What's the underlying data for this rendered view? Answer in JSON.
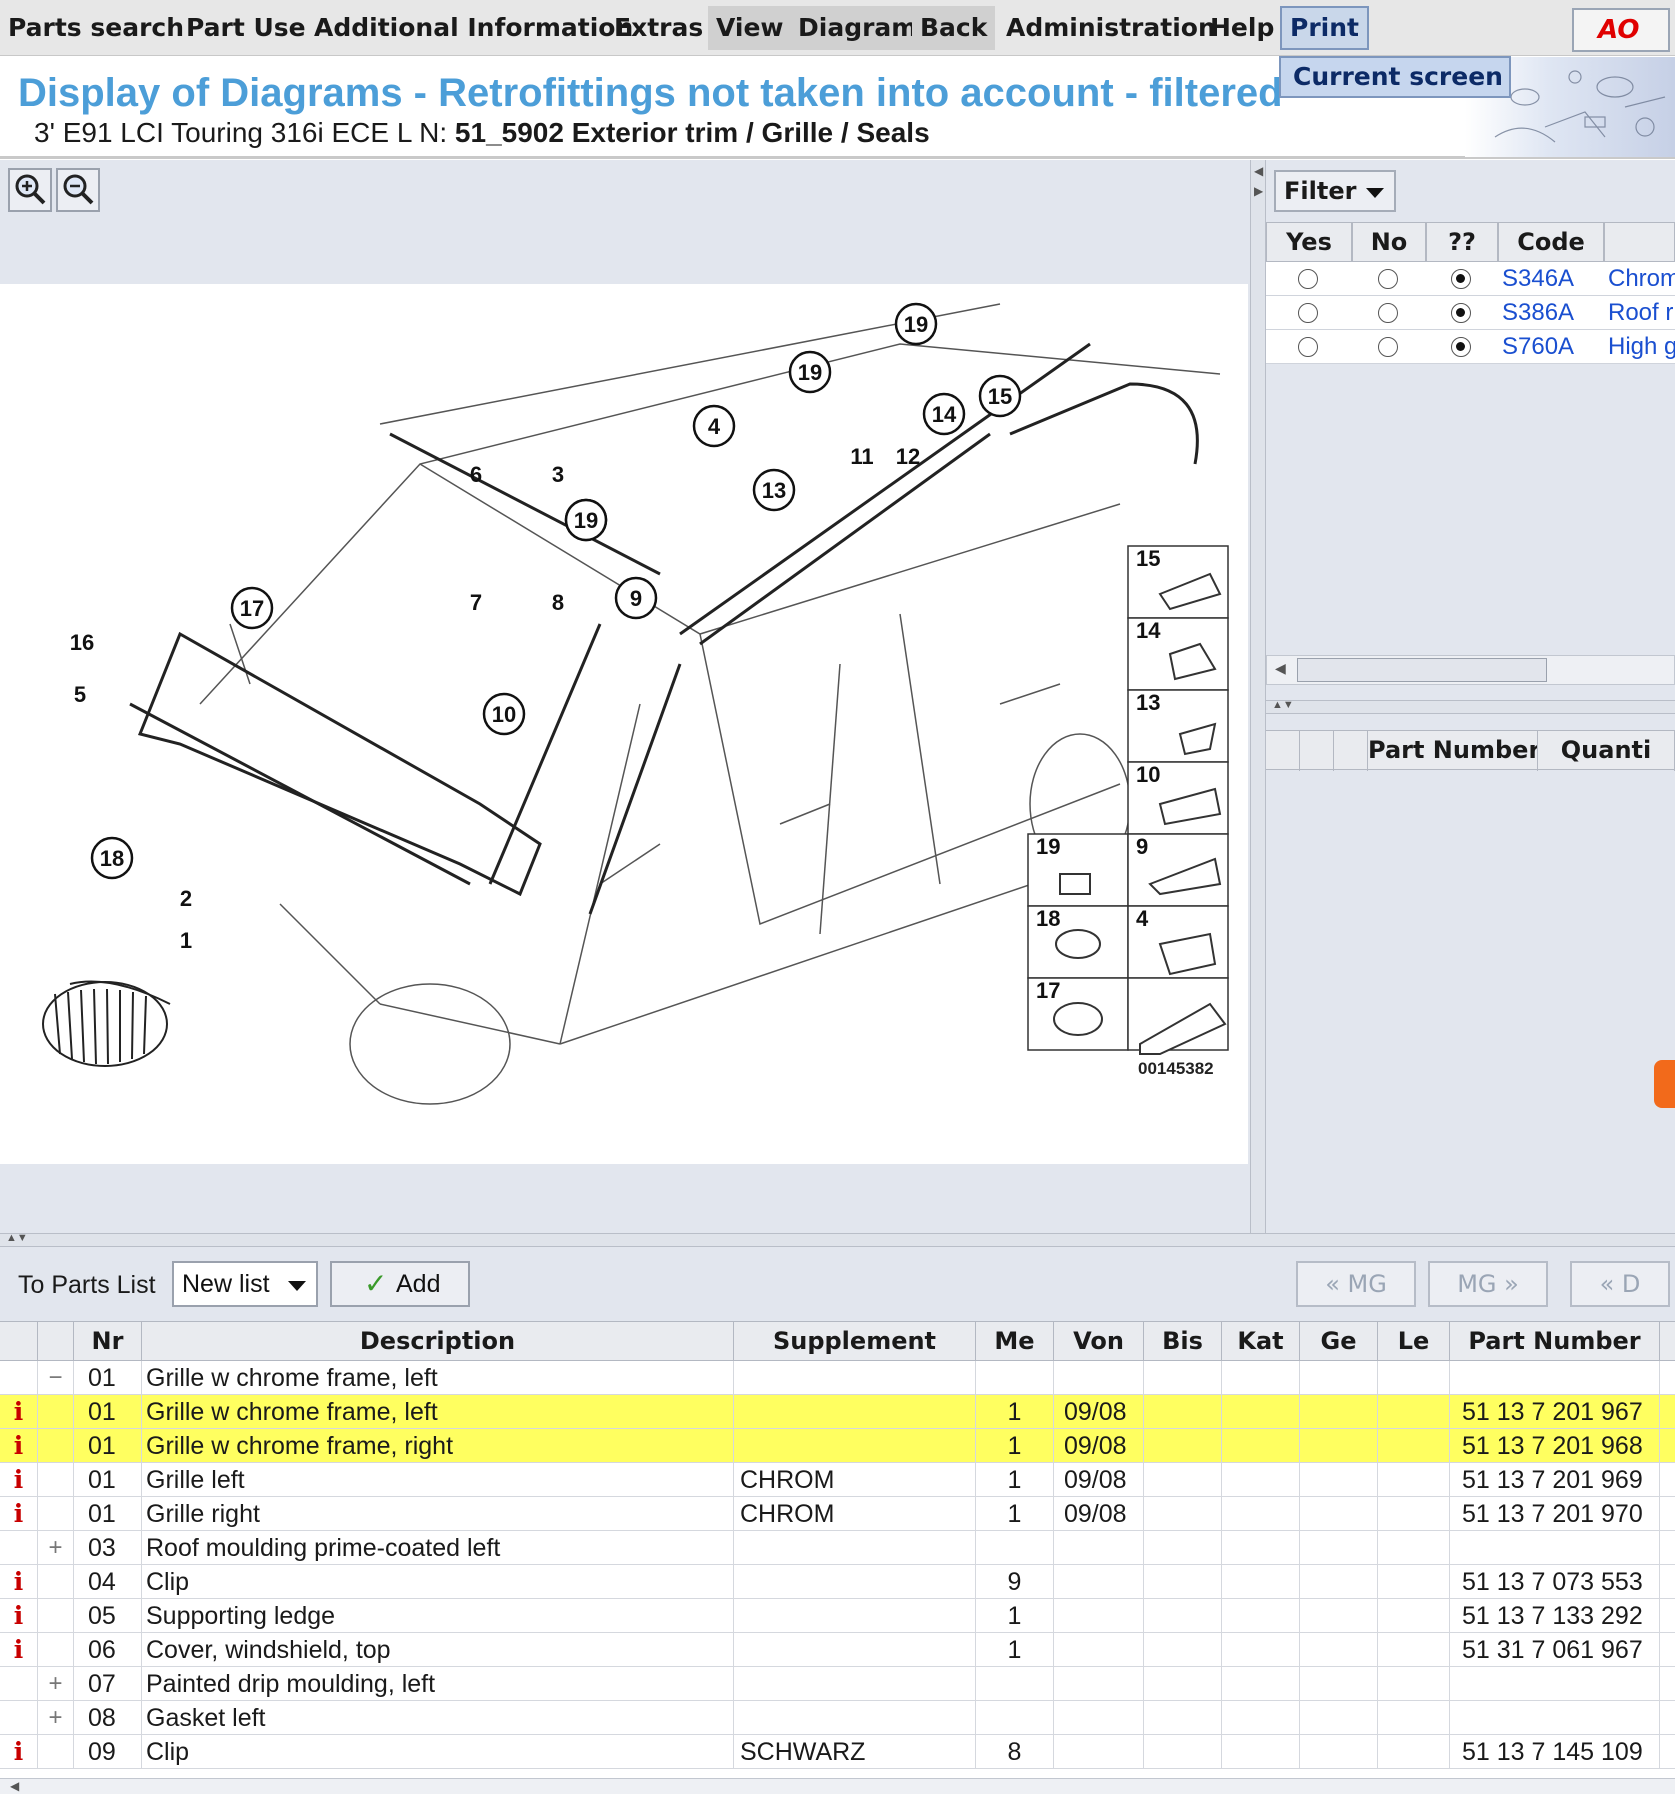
{
  "menu": {
    "items": [
      {
        "label": "Parts search"
      },
      {
        "label": "Part Use"
      },
      {
        "label": "Additional Information"
      },
      {
        "label": "Extras"
      },
      {
        "label": "View"
      },
      {
        "label": "Diagram"
      },
      {
        "label": "Back"
      },
      {
        "label": "Administration"
      },
      {
        "label": "Help"
      },
      {
        "label": "Print"
      }
    ],
    "print_dropdown": "Current screen",
    "logo_icon": "ao-logo-icon"
  },
  "header": {
    "title": "Display of Diagrams - Retrofittings not taken into account - filtered",
    "vehicle": "3' E91 LCI Touring 316i ECE  L N: ",
    "group": "51_5902 Exterior trim / Grille / Seals"
  },
  "diagram": {
    "zoom_in_icon": "zoom-in-icon",
    "zoom_out_icon": "zoom-out-icon",
    "callouts": [
      "19",
      "19",
      "19",
      "4",
      "3",
      "6",
      "19",
      "13",
      "11",
      "12",
      "14",
      "15",
      "9",
      "8",
      "7",
      "17",
      "16",
      "5",
      "10",
      "18",
      "2",
      "1"
    ],
    "legend": [
      "15",
      "14",
      "13",
      "10",
      "19",
      "9",
      "18",
      "4",
      "17"
    ],
    "image_number": "00145382"
  },
  "filter": {
    "button_label": "Filter",
    "columns": [
      "Yes",
      "No",
      "??",
      "Code",
      ""
    ],
    "rows": [
      {
        "code": "S346A",
        "desc": "Chrom",
        "selected": "??"
      },
      {
        "code": "S386A",
        "desc": "Roof r",
        "selected": "??"
      },
      {
        "code": "S760A",
        "desc": "High g",
        "selected": "??"
      }
    ],
    "parts_columns": [
      "",
      "",
      "",
      "Part Number",
      "Quanti"
    ]
  },
  "toolbar": {
    "label": "To Parts List",
    "list_select": "New list",
    "add_label": "Add",
    "prev_mg": "« MG",
    "next_mg": "MG »",
    "prev_d": "« D"
  },
  "parts": {
    "columns": [
      "",
      "",
      "Nr",
      "Description",
      "Supplement",
      "Me",
      "Von",
      "Bis",
      "Kat",
      "Ge",
      "Le",
      "Part Number"
    ],
    "rows": [
      {
        "icon": "",
        "tree": "−",
        "nr": "01",
        "desc": "Grille w chrome frame, left",
        "supp": "",
        "me": "",
        "von": "",
        "pn": "",
        "hl": false
      },
      {
        "icon": "i",
        "tree": "",
        "nr": "01",
        "desc": "Grille w chrome frame, left",
        "supp": "",
        "me": "1",
        "von": "09/08",
        "pn": "51 13 7 201 967",
        "hl": true
      },
      {
        "icon": "i",
        "tree": "",
        "nr": "01",
        "desc": "Grille w chrome frame, right",
        "supp": "",
        "me": "1",
        "von": "09/08",
        "pn": "51 13 7 201 968",
        "hl": true
      },
      {
        "icon": "i",
        "tree": "",
        "nr": "01",
        "desc": "Grille left",
        "supp": "CHROM",
        "me": "1",
        "von": "09/08",
        "pn": "51 13 7 201 969",
        "hl": false
      },
      {
        "icon": "i",
        "tree": "",
        "nr": "01",
        "desc": "Grille right",
        "supp": "CHROM",
        "me": "1",
        "von": "09/08",
        "pn": "51 13 7 201 970",
        "hl": false
      },
      {
        "icon": "",
        "tree": "+",
        "nr": "03",
        "desc": "Roof moulding prime-coated left",
        "supp": "",
        "me": "",
        "von": "",
        "pn": "",
        "hl": false
      },
      {
        "icon": "i",
        "tree": "",
        "nr": "04",
        "desc": "Clip",
        "supp": "",
        "me": "9",
        "von": "",
        "pn": "51 13 7 073 553",
        "hl": false
      },
      {
        "icon": "i",
        "tree": "",
        "nr": "05",
        "desc": "Supporting ledge",
        "supp": "",
        "me": "1",
        "von": "",
        "pn": "51 13 7 133 292",
        "hl": false
      },
      {
        "icon": "i",
        "tree": "",
        "nr": "06",
        "desc": "Cover, windshield, top",
        "supp": "",
        "me": "1",
        "von": "",
        "pn": "51 31 7 061 967",
        "hl": false
      },
      {
        "icon": "",
        "tree": "+",
        "nr": "07",
        "desc": "Painted drip moulding, left",
        "supp": "",
        "me": "",
        "von": "",
        "pn": "",
        "hl": false
      },
      {
        "icon": "",
        "tree": "+",
        "nr": "08",
        "desc": "Gasket left",
        "supp": "",
        "me": "",
        "von": "",
        "pn": "",
        "hl": false
      },
      {
        "icon": "i",
        "tree": "",
        "nr": "09",
        "desc": "Clip",
        "supp": "SCHWARZ",
        "me": "8",
        "von": "",
        "pn": "51 13 7 145 109",
        "hl": false
      }
    ]
  },
  "colors": {
    "title": "#4c9ed8",
    "highlight_row": "#ffff60",
    "info_icon": "#c80000",
    "code_link": "#1a4fd0"
  }
}
